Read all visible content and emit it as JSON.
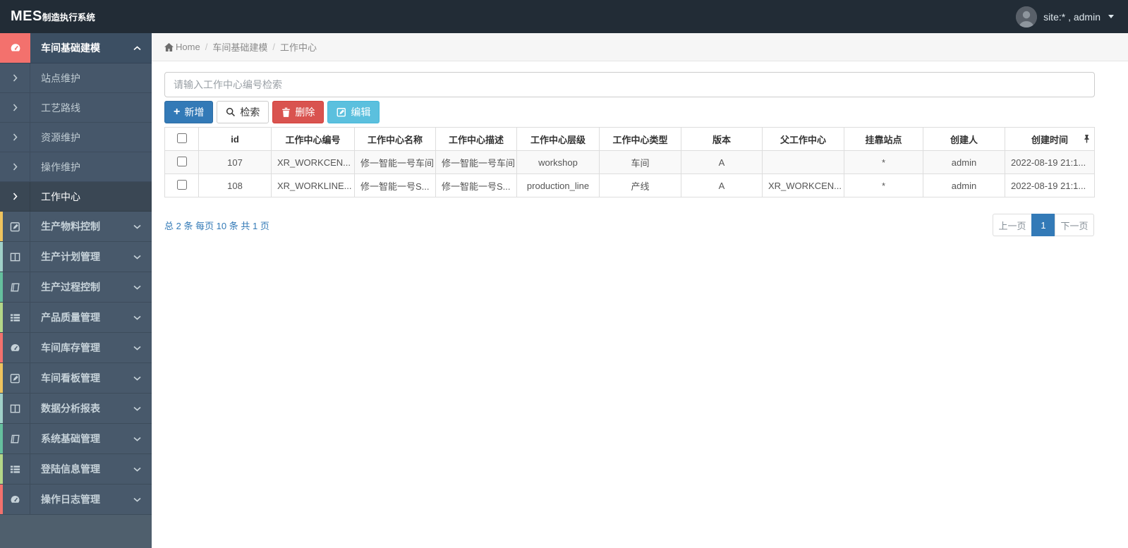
{
  "navbar": {
    "logo_bold": "MES",
    "logo_suffix": "制造执行系统",
    "user_label": "site:* , admin"
  },
  "breadcrumb": {
    "home": "Home",
    "section": "车间基础建模",
    "current": "工作中心"
  },
  "sidebar": {
    "items": [
      {
        "label": "车间基础建模",
        "icon": "tachometer-icon",
        "state": "expanded",
        "accent": "#f3716d",
        "children": [
          "站点维护",
          "工艺路线",
          "资源维护",
          "操作维护",
          "工作中心"
        ],
        "active_child": "工作中心"
      },
      {
        "label": "生产物料控制",
        "icon": "pencil-square-icon",
        "state": "collapsed",
        "accent": "#eec35e"
      },
      {
        "label": "生产计划管理",
        "icon": "columns-icon",
        "state": "collapsed",
        "accent": "#a0d0c8"
      },
      {
        "label": "生产过程控制",
        "icon": "book-icon",
        "state": "collapsed",
        "accent": "#65bf9e"
      },
      {
        "label": "产品质量管理",
        "icon": "th-list-icon",
        "state": "collapsed",
        "accent": "#b4d788"
      },
      {
        "label": "车间库存管理",
        "icon": "tachometer-icon",
        "state": "collapsed",
        "accent": "#f3716d"
      },
      {
        "label": "车间看板管理",
        "icon": "pencil-square-icon",
        "state": "collapsed",
        "accent": "#eec35e"
      },
      {
        "label": "数据分析报表",
        "icon": "columns-icon",
        "state": "collapsed",
        "accent": "#a0d0c8"
      },
      {
        "label": "系统基础管理",
        "icon": "book-icon",
        "state": "collapsed",
        "accent": "#65bf9e"
      },
      {
        "label": "登陆信息管理",
        "icon": "th-list-icon",
        "state": "collapsed",
        "accent": "#b4d788"
      },
      {
        "label": "操作日志管理",
        "icon": "tachometer-icon",
        "state": "collapsed",
        "accent": "#f3716d"
      }
    ]
  },
  "search": {
    "placeholder": "请输入工作中心编号检索",
    "value": ""
  },
  "toolbar": {
    "add_label": "新增",
    "search_label": "检索",
    "delete_label": "删除",
    "edit_label": "编辑"
  },
  "table": {
    "columns": [
      "id",
      "工作中心编号",
      "工作中心名称",
      "工作中心描述",
      "工作中心层级",
      "工作中心类型",
      "版本",
      "父工作中心",
      "挂靠站点",
      "创建人",
      "创建时间"
    ],
    "rows": [
      {
        "id": "107",
        "code": "XR_WORKCEN...",
        "name": "修一智能一号车间",
        "desc": "修一智能一号车间",
        "level": "workshop",
        "type": "车间",
        "version": "A",
        "parent": "",
        "station": "*",
        "creator": "admin",
        "created": "2022-08-19 21:1..."
      },
      {
        "id": "108",
        "code": "XR_WORKLINE...",
        "name": "修一智能一号S...",
        "desc": "修一智能一号S...",
        "level": "production_line",
        "type": "产线",
        "version": "A",
        "parent": "XR_WORKCEN...",
        "station": "*",
        "creator": "admin",
        "created": "2022-08-19 21:1..."
      }
    ]
  },
  "pagination": {
    "summary": "总 2 条  每页 10 条  共 1 页",
    "prev_label": "上一页",
    "current_page": "1",
    "next_label": "下一页"
  },
  "colors": {
    "navbar_bg": "#222c36",
    "sidebar_bg": "#48596b",
    "active_group_bg": "#3c4f63",
    "active_submenu_bg": "#3a4754",
    "primary": "#337ab7",
    "danger": "#d9534f",
    "info": "#5bc0de",
    "accent_red": "#f3716d",
    "accent_yellow": "#eec35e",
    "accent_teal": "#a0d0c8",
    "accent_green": "#65bf9e",
    "accent_ygreen": "#b4d788",
    "breadcrumb_bg": "#f6f6f6",
    "stripe_row_bg": "#f9f9f9"
  }
}
